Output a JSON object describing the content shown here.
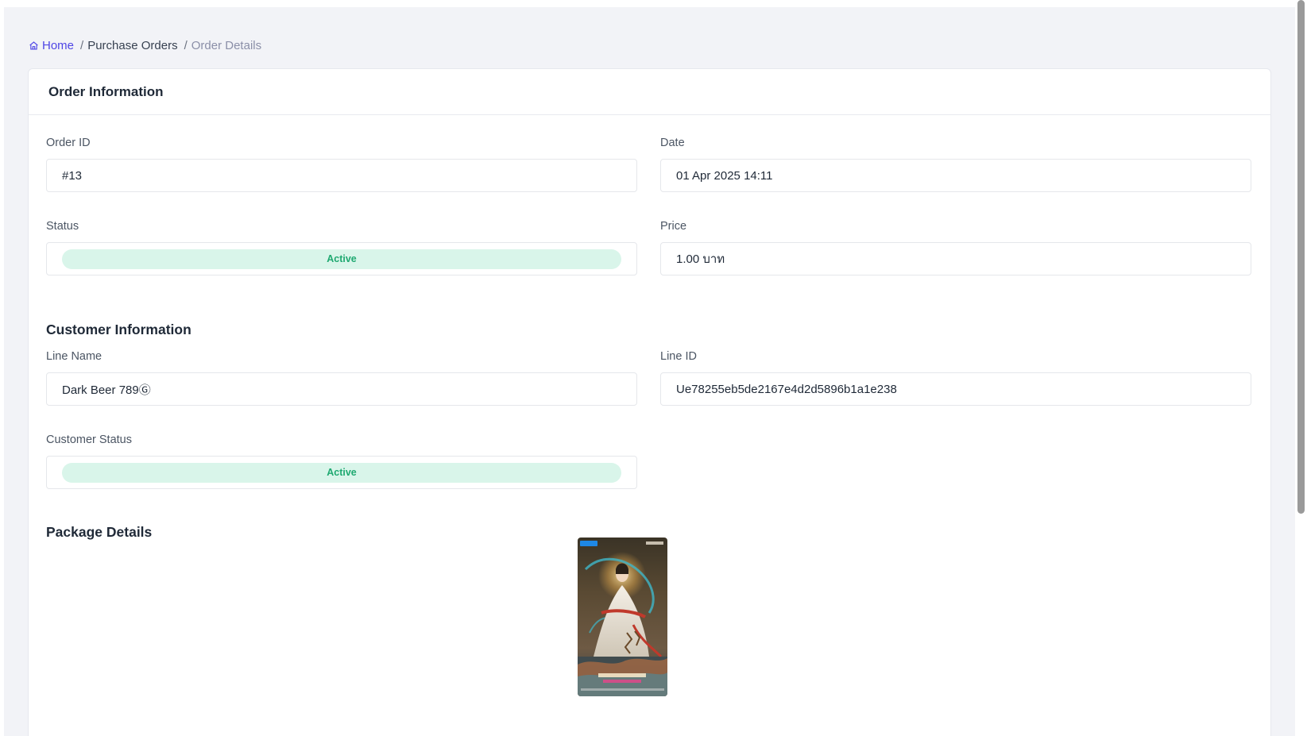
{
  "breadcrumb": {
    "home": "Home",
    "purchase_orders": "Purchase Orders",
    "current": "Order Details",
    "separator": "/"
  },
  "order_info": {
    "title": "Order Information",
    "order_id_label": "Order ID",
    "order_id_value": "#13",
    "date_label": "Date",
    "date_value": "01 Apr 2025 14:11",
    "status_label": "Status",
    "status_value": "Active",
    "price_label": "Price",
    "price_value": "1.00 บาท"
  },
  "customer_info": {
    "title": "Customer Information",
    "line_name_label": "Line Name",
    "line_name_value": "Dark Beer 789Ⓖ",
    "line_id_label": "Line ID",
    "line_id_value": "Ue78255eb5de2167e4d2d5896b1a1e238",
    "customer_status_label": "Customer Status",
    "customer_status_value": "Active"
  },
  "package_details": {
    "title": "Package Details"
  },
  "colors": {
    "accent": "#4f46e5",
    "active_badge_bg": "#d9f5ea",
    "active_badge_text": "#1fa971",
    "page_bg": "#f2f3f7"
  },
  "icons": {
    "home": "home-icon"
  }
}
